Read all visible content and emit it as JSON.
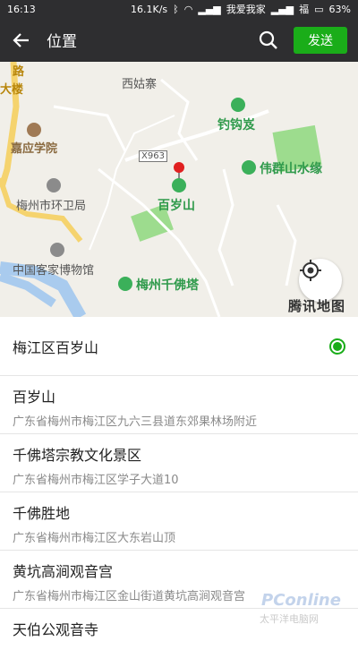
{
  "status": {
    "time": "16:13",
    "speed": "16.1K/s",
    "carrier": "我爱我家",
    "carrier2": "福",
    "battery": "63%"
  },
  "header": {
    "title": "位置",
    "send_label": "发送"
  },
  "map": {
    "labels": {
      "road": "路",
      "building": "大楼",
      "xiguzhai": "西姑寨",
      "jiaying": "嘉应学院",
      "huanwei": "梅州市环卫局",
      "museum": "中国客家博物馆",
      "x963": "X963",
      "baisui": "百岁山",
      "diaogouan": "钓钩岌",
      "weiqun": "伟群山水缘",
      "qianfota": "梅州千佛塔"
    },
    "logo": "腾讯地图"
  },
  "places": [
    {
      "name": "梅江区百岁山",
      "addr": ""
    },
    {
      "name": "百岁山",
      "addr": "广东省梅州市梅江区九六三县道东郊果林场附近"
    },
    {
      "name": "千佛塔宗教文化景区",
      "addr": "广东省梅州市梅江区学子大道10"
    },
    {
      "name": "千佛胜地",
      "addr": "广东省梅州市梅江区大东岩山顶"
    },
    {
      "name": "黄坑高涧观音宫",
      "addr": "广东省梅州市梅江区金山街道黄坑高涧观音宫"
    },
    {
      "name": "天伯公观音寺",
      "addr": ""
    }
  ],
  "watermark": {
    "brand": "PConline",
    "sub": "太平洋电脑网"
  },
  "colors": {
    "accent": "#1aad19",
    "bar": "#2e2e30",
    "park": "#3bb05a"
  }
}
